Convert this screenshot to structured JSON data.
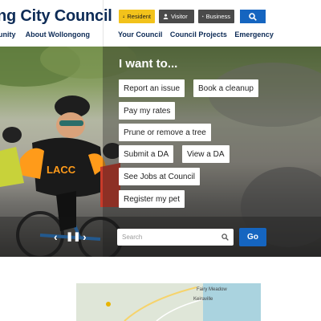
{
  "header": {
    "brand": "ng City Council",
    "left_links": [
      "unity",
      "About Wollongong"
    ],
    "right_links": [
      "Your Council",
      "Council Projects",
      "Emergency"
    ],
    "audience": [
      "Resident",
      "Visitor",
      "Business"
    ]
  },
  "hero": {
    "heading": "I want to...",
    "quick_links": [
      "Report an issue",
      "Book a cleanup",
      "Pay my rates",
      "Prune or remove a tree",
      "Submit a DA",
      "View a DA",
      "See Jobs at Council",
      "Register my pet"
    ],
    "search_placeholder": "Search",
    "go_label": "Go",
    "controls": {
      "prev": "‹",
      "pause": "❚❚",
      "next": "›"
    }
  },
  "map": {
    "labels": [
      "Fairy Meadow",
      "Keiraville"
    ]
  },
  "colors": {
    "navy": "#0d2b56",
    "accent_blue": "#1565c0",
    "resident_yellow": "#f2c21b",
    "dark_button": "#4a4a4a"
  },
  "icons": [
    "user-icon",
    "briefcase-icon",
    "search-icon"
  ]
}
